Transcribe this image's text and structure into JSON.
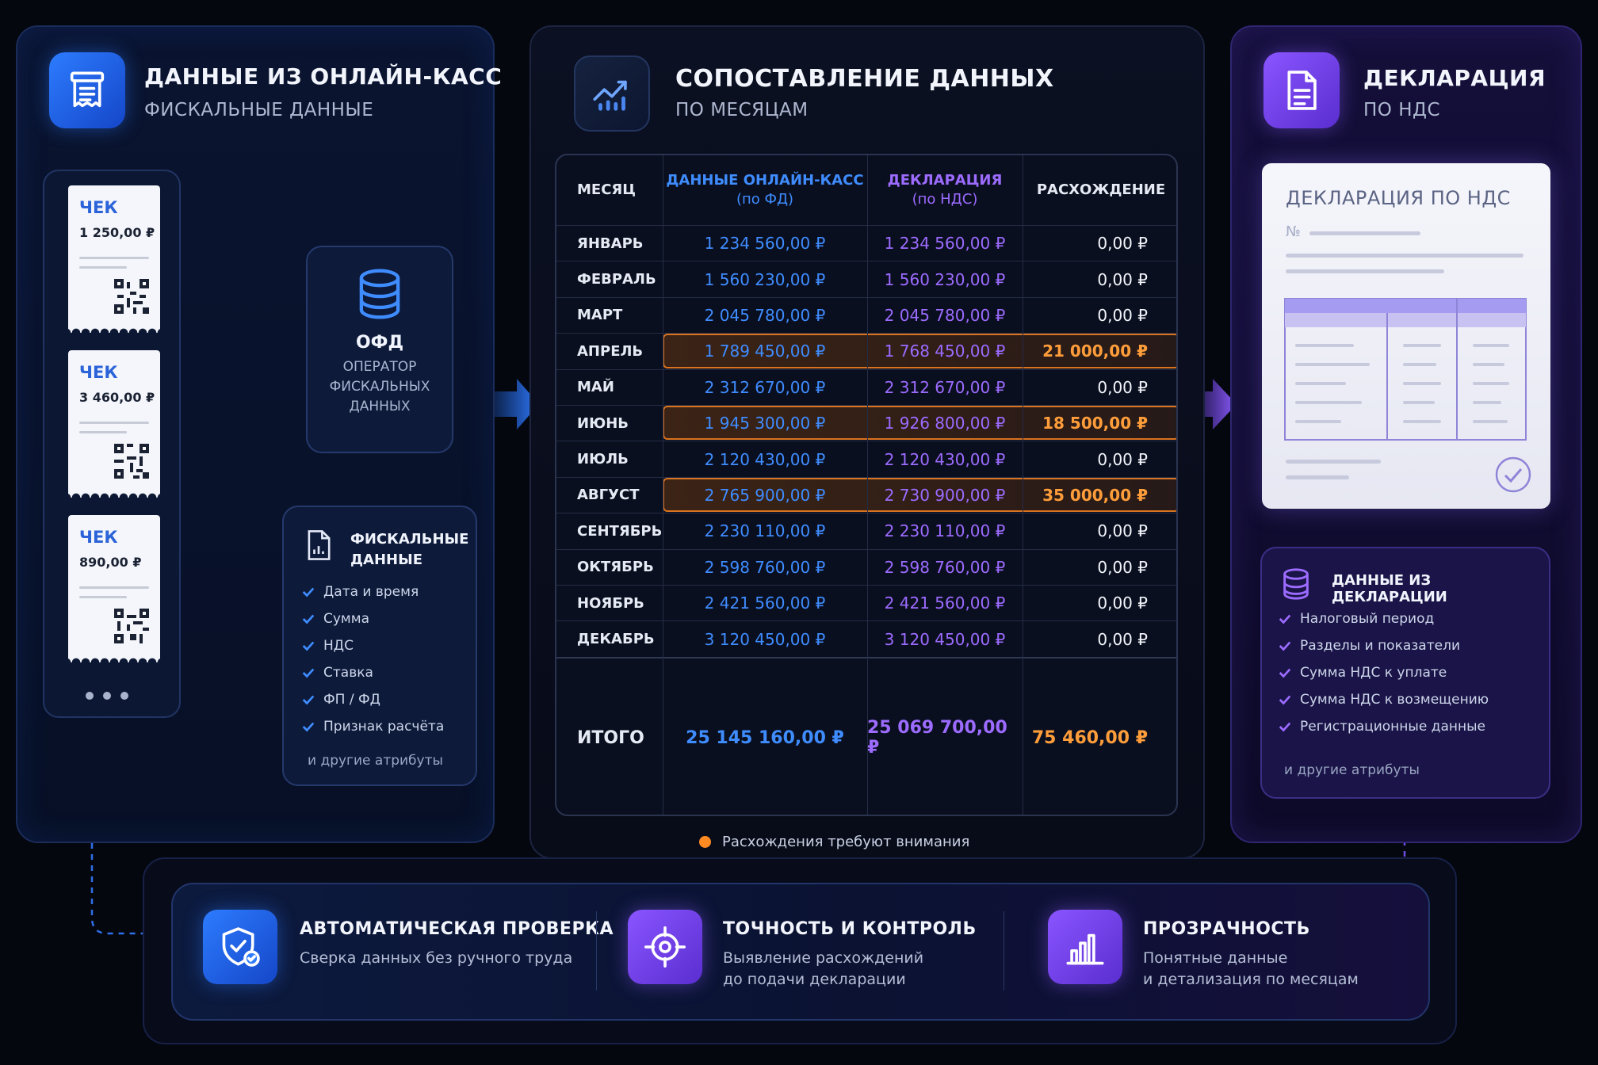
{
  "left_panel": {
    "title": "ДАННЫЕ ИЗ ОНЛАЙН-КАСС",
    "subtitle": "ФИСКАЛЬНЫЕ ДАННЫЕ",
    "receipts": [
      {
        "label": "ЧЕК",
        "amount": "1 250,00 ₽"
      },
      {
        "label": "ЧЕК",
        "amount": "3 460,00 ₽"
      },
      {
        "label": "ЧЕК",
        "amount": "890,00 ₽"
      }
    ],
    "ofd": {
      "title": "ОФД",
      "subtitle_lines": [
        "ОПЕРАТОР",
        "ФИСКАЛЬНЫХ",
        "ДАННЫХ"
      ]
    },
    "fiscal": {
      "title_lines": [
        "ФИСКАЛЬНЫЕ",
        "ДАННЫЕ"
      ],
      "items": [
        "Дата и время",
        "Сумма",
        "НДС",
        "Ставка",
        "ФП / ФД",
        "Признак расчёта"
      ],
      "more": "и другие атрибуты"
    }
  },
  "middle_panel": {
    "title": "СОПОСТАВЛЕНИЕ ДАННЫХ",
    "subtitle": "ПО МЕСЯЦАМ",
    "columns": {
      "month": "МЕСЯЦ",
      "ofd": "ДАННЫЕ ОНЛАЙН-КАСС",
      "ofd_sub": "(по ФД)",
      "decl": "ДЕКЛАРАЦИЯ",
      "decl_sub": "(по НДС)",
      "diff": "РАСХОЖДЕНИЕ"
    },
    "rows": [
      {
        "month": "ЯНВАРЬ",
        "ofd": "1 234 560,00 ₽",
        "decl": "1 234 560,00 ₽",
        "diff": "0,00 ₽",
        "flag": false
      },
      {
        "month": "ФЕВРАЛЬ",
        "ofd": "1 560 230,00 ₽",
        "decl": "1 560 230,00 ₽",
        "diff": "0,00 ₽",
        "flag": false
      },
      {
        "month": "МАРТ",
        "ofd": "2 045 780,00 ₽",
        "decl": "2 045 780,00 ₽",
        "diff": "0,00 ₽",
        "flag": false
      },
      {
        "month": "АПРЕЛЬ",
        "ofd": "1 789 450,00 ₽",
        "decl": "1 768 450,00 ₽",
        "diff": "21 000,00 ₽",
        "flag": true
      },
      {
        "month": "МАЙ",
        "ofd": "2 312 670,00 ₽",
        "decl": "2 312 670,00 ₽",
        "diff": "0,00 ₽",
        "flag": false
      },
      {
        "month": "ИЮНЬ",
        "ofd": "1 945 300,00 ₽",
        "decl": "1 926 800,00 ₽",
        "diff": "18 500,00 ₽",
        "flag": true
      },
      {
        "month": "ИЮЛЬ",
        "ofd": "2 120 430,00 ₽",
        "decl": "2 120 430,00 ₽",
        "diff": "0,00 ₽",
        "flag": false
      },
      {
        "month": "АВГУСТ",
        "ofd": "2 765 900,00 ₽",
        "decl": "2 730 900,00 ₽",
        "diff": "35 000,00 ₽",
        "flag": true
      },
      {
        "month": "СЕНТЯБРЬ",
        "ofd": "2 230 110,00 ₽",
        "decl": "2 230 110,00 ₽",
        "diff": "0,00 ₽",
        "flag": false
      },
      {
        "month": "ОКТЯБРЬ",
        "ofd": "2 598 760,00 ₽",
        "decl": "2 598 760,00 ₽",
        "diff": "0,00 ₽",
        "flag": false
      },
      {
        "month": "НОЯБРЬ",
        "ofd": "2 421 560,00 ₽",
        "decl": "2 421 560,00 ₽",
        "diff": "0,00 ₽",
        "flag": false
      },
      {
        "month": "ДЕКАБРЬ",
        "ofd": "3 120 450,00 ₽",
        "decl": "3 120 450,00 ₽",
        "diff": "0,00 ₽",
        "flag": false
      }
    ],
    "total": {
      "month": "ИТОГО",
      "ofd": "25 145 160,00 ₽",
      "decl": "25 069 700,00 ₽",
      "diff": "75 460,00 ₽"
    },
    "legend": "Расхождения требуют внимания"
  },
  "right_panel": {
    "title": "ДЕКЛАРАЦИЯ",
    "subtitle": "ПО НДС",
    "doc_title": "ДЕКЛАРАЦИЯ ПО НДС",
    "doc_number_label": "№",
    "decl_data": {
      "title": "ДАННЫЕ ИЗ ДЕКЛАРАЦИИ",
      "items": [
        "Налоговый период",
        "Разделы и показатели",
        "Сумма НДС к уплате",
        "Сумма НДС к возмещению",
        "Регистрационные данные"
      ],
      "more": "и другие атрибуты"
    }
  },
  "features": [
    {
      "title": "АВТОМАТИЧЕСКАЯ ПРОВЕРКА",
      "lines": [
        "Сверка данных без ручного труда"
      ],
      "icon": "shield-check-icon"
    },
    {
      "title": "ТОЧНОСТЬ И КОНТРОЛЬ",
      "lines": [
        "Выявление расхождений",
        "до подачи декларации"
      ],
      "icon": "target-icon"
    },
    {
      "title": "ПРОЗРАЧНОСТЬ",
      "lines": [
        "Понятные данные",
        "и детализация по месяцам"
      ],
      "icon": "bar-chart-icon"
    }
  ],
  "colors": {
    "blue": "#3f8cff",
    "purple": "#9c6bff",
    "orange": "#ff9d3a",
    "background": "#05070f"
  }
}
